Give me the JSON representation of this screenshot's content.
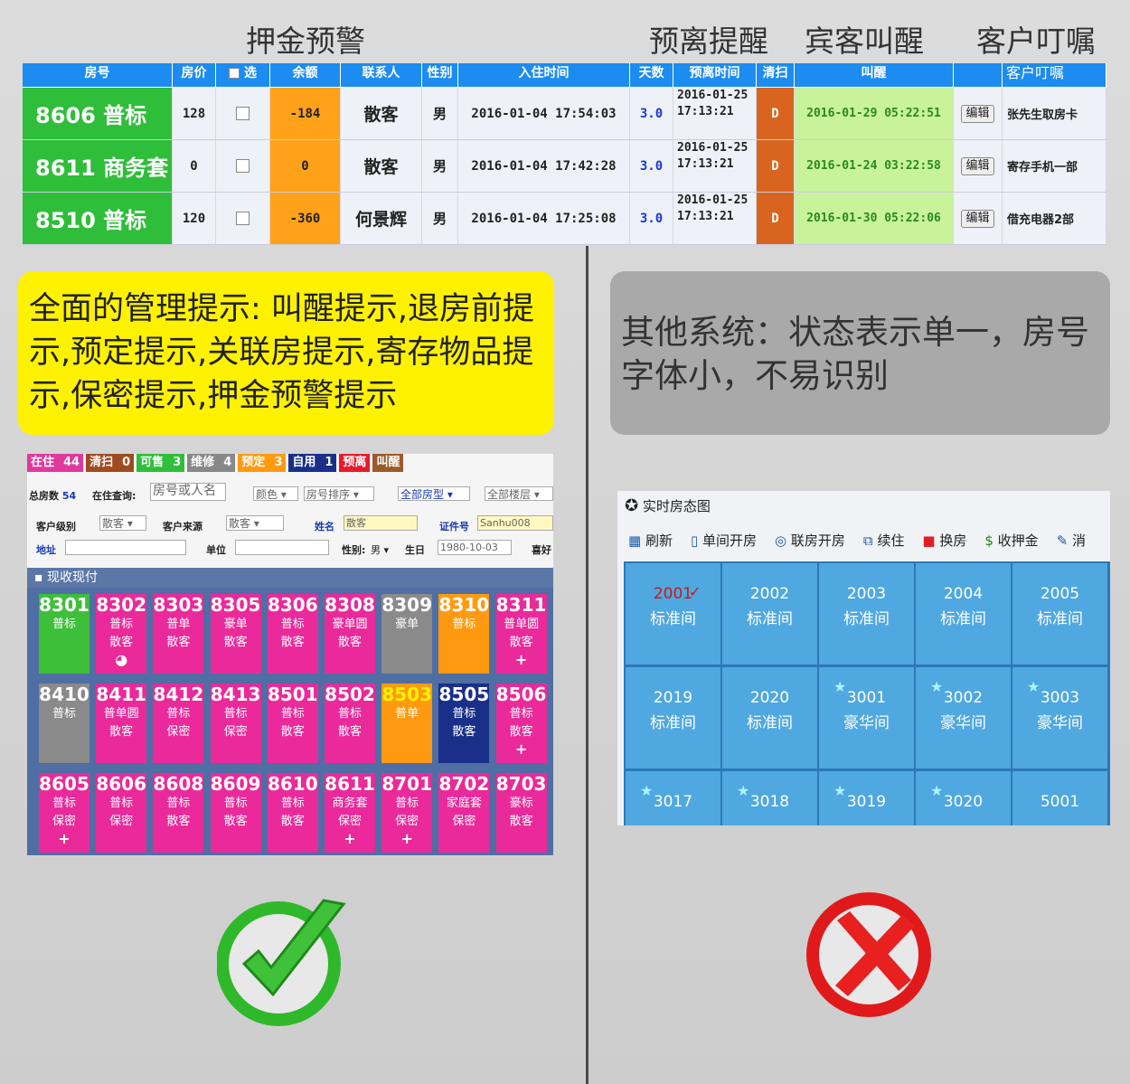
{
  "headers": {
    "deposit_warning": "押金预警",
    "checkout_reminder": "预离提醒",
    "guest_wakeup": "宾客叫醒",
    "customer_note": "客户叮嘱"
  },
  "table": {
    "columns": [
      "房号",
      "房价",
      "选",
      "余额",
      "联系人",
      "性别",
      "入住时间",
      "天数",
      "预离时间",
      "清扫",
      "叫醒",
      "",
      "客户叮嘱"
    ],
    "rows": [
      {
        "room": "8606 普标",
        "price": "128",
        "balance": "-184",
        "contact": "散客",
        "gender": "男",
        "checkin": "2016-01-04 17:54:03",
        "days": "3.0",
        "checkout": "2016-01-25 17:13:21",
        "clean": "D",
        "wakeup": "2016-01-29 05:22:51",
        "edit": "编辑",
        "note": "张先生取房卡"
      },
      {
        "room": "8611 商务套",
        "price": "0",
        "balance": "0",
        "contact": "散客",
        "gender": "男",
        "checkin": "2016-01-04 17:42:28",
        "days": "3.0",
        "checkout": "2016-01-25 17:13:21",
        "clean": "D",
        "wakeup": "2016-01-24 03:22:58",
        "edit": "编辑",
        "note": "寄存手机一部"
      },
      {
        "room": "8510 普标",
        "price": "120",
        "balance": "-360",
        "contact": "何景辉",
        "gender": "男",
        "checkin": "2016-01-04 17:25:08",
        "days": "3.0",
        "checkout": "2016-01-25 17:13:21",
        "clean": "D",
        "wakeup": "2016-01-30 05:22:06",
        "edit": "编辑",
        "note": "借充电器2部"
      }
    ]
  },
  "callouts": {
    "good": "全面的管理提示: 叫醒提示,退房前提示,预定提示,关联房提示,寄存物品提示,保密提示,押金预警提示",
    "bad": "其他系统：状态表示单一，房号字体小，不易识别"
  },
  "left_app": {
    "status": [
      {
        "label": "在住",
        "count": "44",
        "color": "#e0389c"
      },
      {
        "label": "清扫",
        "count": "0",
        "color": "#a04a20"
      },
      {
        "label": "可售",
        "count": "3",
        "color": "#2fbe3a"
      },
      {
        "label": "维修",
        "count": "4",
        "color": "#888888"
      },
      {
        "label": "预定",
        "count": "3",
        "color": "#ff9a10"
      },
      {
        "label": "自用",
        "count": "1",
        "color": "#1a2f8a"
      },
      {
        "label": "预离",
        "count": "",
        "color": "#e81a2a"
      },
      {
        "label": "叫醒",
        "count": "",
        "color": "#9a5a2a"
      }
    ],
    "total_label": "总房数",
    "total_value": "54",
    "search_label": "在住查询:",
    "search_placeholder": "房号或人名",
    "color_select": "颜色",
    "sort_select": "房号排序",
    "type_select": "全部房型",
    "floor_select": "全部楼层",
    "level_label": "客户级别",
    "level_value": "散客",
    "source_label": "客户来源",
    "source_value": "散客",
    "name_label": "姓名",
    "name_value": "散客",
    "id_label": "证件号",
    "id_value": "Sanhu008",
    "addr_label": "地址",
    "unit_label": "单位",
    "sex_label": "性别:",
    "sex_value": "男",
    "birth_label": "生日",
    "birth_value": "1980-10-03",
    "like_label": "喜好",
    "section": "现收现付",
    "rooms": [
      {
        "num": "8301",
        "t1": "普标",
        "t2": "",
        "mk": "",
        "bg": "#3dbf3a"
      },
      {
        "num": "8302",
        "t1": "普标",
        "t2": "散客",
        "mk": "◕",
        "bg": "#ea2a9a"
      },
      {
        "num": "8303",
        "t1": "普单",
        "t2": "散客",
        "mk": "",
        "bg": "#ea2a9a"
      },
      {
        "num": "8305",
        "t1": "豪单",
        "t2": "散客",
        "mk": "",
        "bg": "#ea2a9a"
      },
      {
        "num": "8306",
        "t1": "普标",
        "t2": "散客",
        "mk": "",
        "bg": "#ea2a9a"
      },
      {
        "num": "8308",
        "t1": "豪单圆",
        "t2": "散客",
        "mk": "",
        "bg": "#ea2a9a"
      },
      {
        "num": "8309",
        "t1": "豪单",
        "t2": "",
        "mk": "",
        "bg": "#8a8a8a"
      },
      {
        "num": "8310",
        "t1": "普标",
        "t2": "",
        "mk": "",
        "bg": "#ff9a10"
      },
      {
        "num": "8311",
        "t1": "普单圆",
        "t2": "散客",
        "mk": "+",
        "bg": "#ea2a9a"
      },
      {
        "num": "8410",
        "t1": "普标",
        "t2": "",
        "mk": "",
        "bg": "#8a8a8a"
      },
      {
        "num": "8411",
        "t1": "普单圆",
        "t2": "散客",
        "mk": "",
        "bg": "#ea2a9a"
      },
      {
        "num": "8412",
        "t1": "普标",
        "t2": "保密",
        "mk": "",
        "bg": "#ea2a9a"
      },
      {
        "num": "8413",
        "t1": "普标",
        "t2": "保密",
        "mk": "",
        "bg": "#ea2a9a"
      },
      {
        "num": "8501",
        "t1": "普标",
        "t2": "散客",
        "mk": "",
        "bg": "#ea2a9a"
      },
      {
        "num": "8502",
        "t1": "普标",
        "t2": "散客",
        "mk": "",
        "bg": "#ea2a9a"
      },
      {
        "num": "8503",
        "t1": "普单",
        "t2": "",
        "mk": "",
        "bg": "#ff9a10",
        "numcolor": "#fff200"
      },
      {
        "num": "8505",
        "t1": "普标",
        "t2": "散客",
        "mk": "",
        "bg": "#1a2f8a"
      },
      {
        "num": "8506",
        "t1": "普标",
        "t2": "散客",
        "mk": "+",
        "bg": "#ea2a9a"
      },
      {
        "num": "8605",
        "t1": "普标",
        "t2": "保密",
        "mk": "+",
        "bg": "#ea2a9a"
      },
      {
        "num": "8606",
        "t1": "普标",
        "t2": "保密",
        "mk": "",
        "bg": "#ea2a9a"
      },
      {
        "num": "8608",
        "t1": "普标",
        "t2": "散客",
        "mk": "",
        "bg": "#ea2a9a"
      },
      {
        "num": "8609",
        "t1": "普标",
        "t2": "散客",
        "mk": "",
        "bg": "#ea2a9a"
      },
      {
        "num": "8610",
        "t1": "普标",
        "t2": "散客",
        "mk": "",
        "bg": "#ea2a9a"
      },
      {
        "num": "8611",
        "t1": "商务套",
        "t2": "保密",
        "mk": "+",
        "bg": "#ea2a9a"
      },
      {
        "num": "8701",
        "t1": "普标",
        "t2": "保密",
        "mk": "+",
        "bg": "#ea2a9a"
      },
      {
        "num": "8702",
        "t1": "家庭套",
        "t2": "保密",
        "mk": "",
        "bg": "#ea2a9a"
      },
      {
        "num": "8703",
        "t1": "豪标",
        "t2": "散客",
        "mk": "",
        "bg": "#ea2a9a"
      }
    ]
  },
  "right_app": {
    "title": "实时房态图",
    "toolbar": [
      "刷新",
      "单间开房",
      "联房开房",
      "续住",
      "换房",
      "收押金",
      "消"
    ],
    "rooms": [
      {
        "num": "2001",
        "type": "标准间",
        "star": false,
        "check": true
      },
      {
        "num": "2002",
        "type": "标准间",
        "star": false
      },
      {
        "num": "2003",
        "type": "标准间",
        "star": false
      },
      {
        "num": "2004",
        "type": "标准间",
        "star": false
      },
      {
        "num": "2005",
        "type": "标准间",
        "star": false
      },
      {
        "num": "2019",
        "type": "标准间",
        "star": false
      },
      {
        "num": "2020",
        "type": "标准间",
        "star": false
      },
      {
        "num": "3001",
        "type": "豪华间",
        "star": true
      },
      {
        "num": "3002",
        "type": "豪华间",
        "star": true
      },
      {
        "num": "3003",
        "type": "豪华间",
        "star": true
      },
      {
        "num": "3017",
        "type": "",
        "star": true
      },
      {
        "num": "3018",
        "type": "",
        "star": true
      },
      {
        "num": "3019",
        "type": "",
        "star": true
      },
      {
        "num": "3020",
        "type": "",
        "star": true
      },
      {
        "num": "5001",
        "type": "",
        "star": false
      }
    ]
  }
}
